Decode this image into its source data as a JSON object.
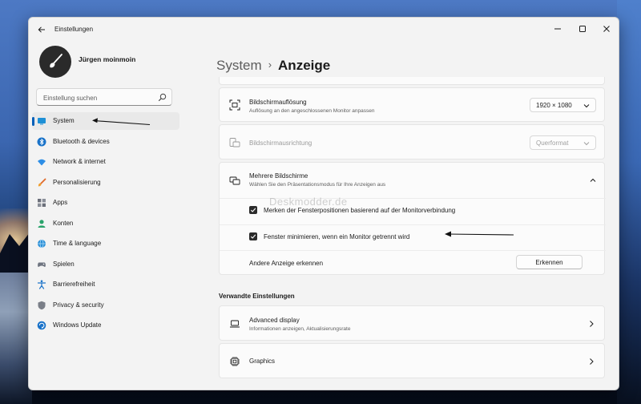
{
  "window": {
    "title": "Einstellungen"
  },
  "profile": {
    "name": "Jürgen moinmoin"
  },
  "search": {
    "placeholder": "Einstellung suchen"
  },
  "sidebar": {
    "items": [
      {
        "label": "System",
        "icon": "monitor-icon",
        "active": true
      },
      {
        "label": "Bluetooth & devices",
        "icon": "bluetooth-icon"
      },
      {
        "label": "Network & internet",
        "icon": "wifi-icon"
      },
      {
        "label": "Personalisierung",
        "icon": "brush-icon"
      },
      {
        "label": "Apps",
        "icon": "apps-icon"
      },
      {
        "label": "Konten",
        "icon": "person-icon"
      },
      {
        "label": "Time & language",
        "icon": "globe-icon"
      },
      {
        "label": "Spielen",
        "icon": "gamepad-icon"
      },
      {
        "label": "Barrierefreiheit",
        "icon": "accessibility-icon"
      },
      {
        "label": "Privacy & security",
        "icon": "shield-icon"
      },
      {
        "label": "Windows Update",
        "icon": "update-icon"
      }
    ]
  },
  "header": {
    "parent": "System",
    "separator": "›",
    "current": "Anzeige"
  },
  "resolution": {
    "title": "Bildschirmauflösung",
    "subtitle": "Auflösung an den angeschlossenen Monitor anpassen",
    "value": "1920 × 1080"
  },
  "orientation": {
    "title": "Bildschirmausrichtung",
    "value": "Querformat"
  },
  "multi": {
    "title": "Mehrere Bildschirme",
    "subtitle": "Wählen Sie den Präsentationsmodus für Ihre Anzeigen aus",
    "option1": "Merken der Fensterpositionen basierend auf der Monitorverbindung",
    "option2": "Fenster minimieren, wenn ein Monitor getrennt wird",
    "detect_label": "Andere Anzeige erkennen",
    "detect_button": "Erkennen"
  },
  "related": {
    "heading": "Verwandte Einstellungen",
    "advanced_title": "Advanced display",
    "advanced_subtitle": "Informationen anzeigen, Aktualisierungsrate",
    "graphics_title": "Graphics"
  },
  "watermark": "Deskmodder.de",
  "colors": {
    "accent": "#005fb8",
    "window_bg": "#f3f3f3",
    "card_bg": "#fbfbfb"
  }
}
